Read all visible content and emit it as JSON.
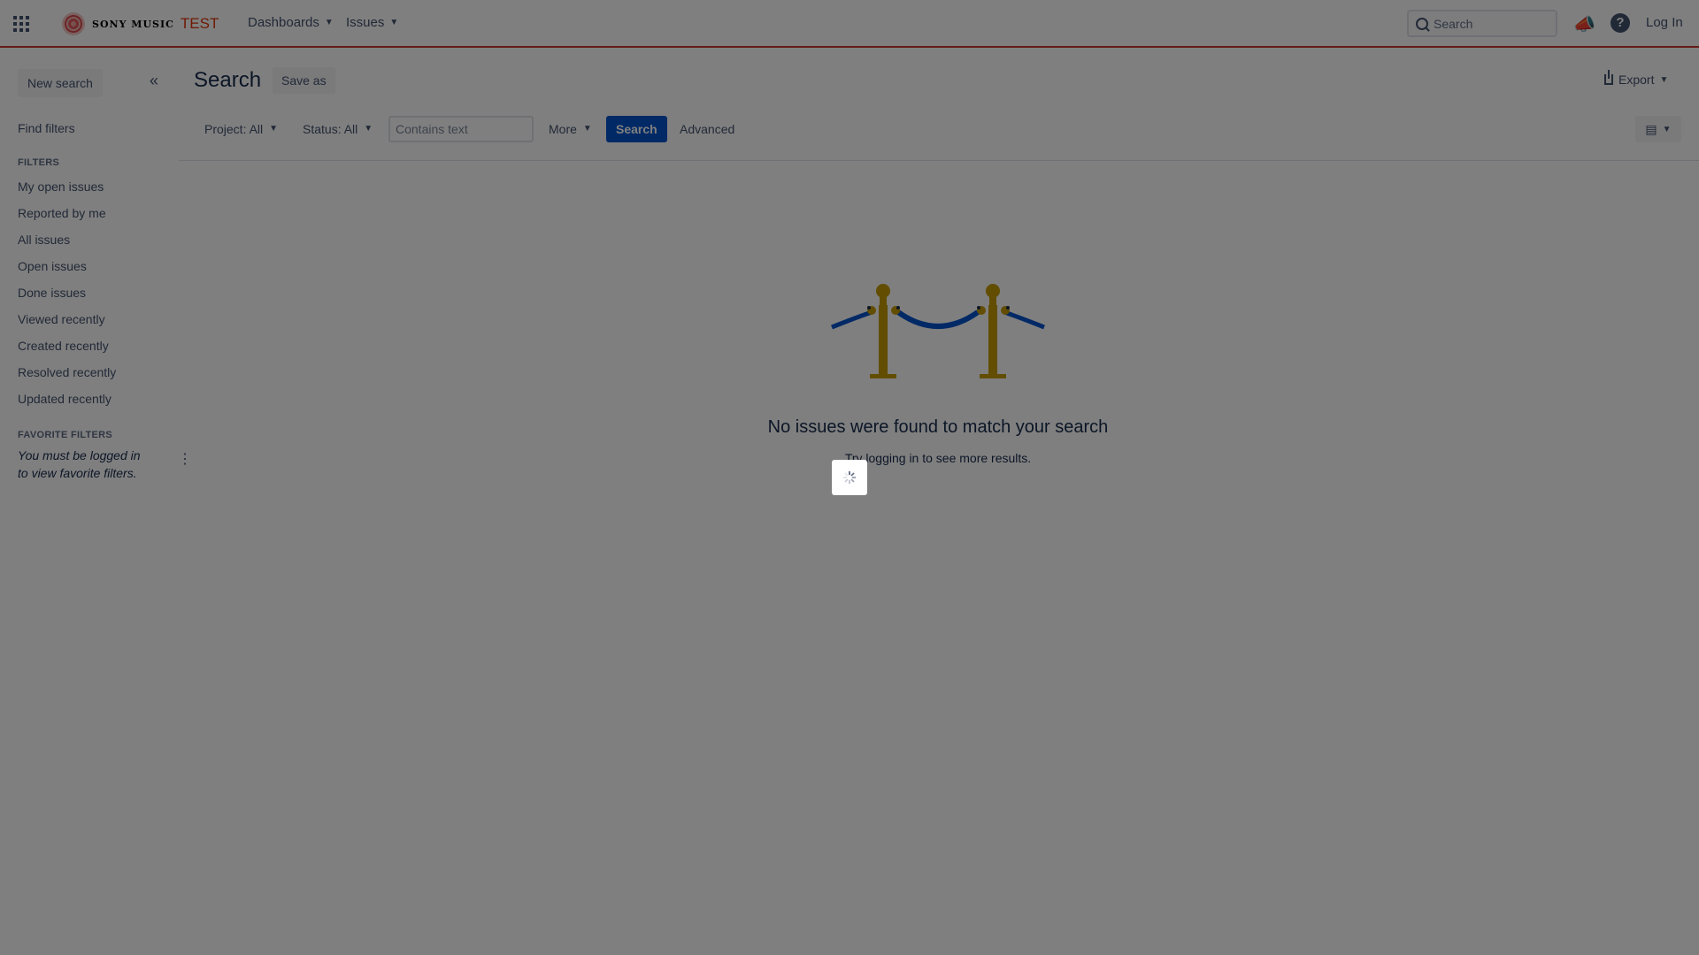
{
  "header": {
    "brand": "SONY MUSIC",
    "brand_suffix": "TEST",
    "nav": [
      {
        "label": "Dashboards"
      },
      {
        "label": "Issues"
      }
    ],
    "search_placeholder": "Search",
    "login_label": "Log In"
  },
  "sidebar": {
    "new_search_label": "New search",
    "find_filters_label": "Find filters",
    "filters_heading": "FILTERS",
    "filters": [
      "My open issues",
      "Reported by me",
      "All issues",
      "Open issues",
      "Done issues",
      "Viewed recently",
      "Created recently",
      "Resolved recently",
      "Updated recently"
    ],
    "favorite_heading": "FAVORITE FILTERS",
    "favorite_message": "You must be logged in to view favorite filters."
  },
  "main": {
    "title": "Search",
    "save_as_label": "Save as",
    "export_label": "Export",
    "filter_bar": {
      "project_label": "Project: All",
      "status_label": "Status: All",
      "text_placeholder": "Contains text",
      "more_label": "More",
      "search_button_label": "Search",
      "advanced_label": "Advanced"
    },
    "empty_state": {
      "title": "No issues were found to match your search",
      "subtitle": "Try logging in to see more results."
    }
  },
  "colors": {
    "header_accent": "#c9372c",
    "primary_button": "#0052cc",
    "overlay": "rgba(0,0,0,0.5)"
  }
}
